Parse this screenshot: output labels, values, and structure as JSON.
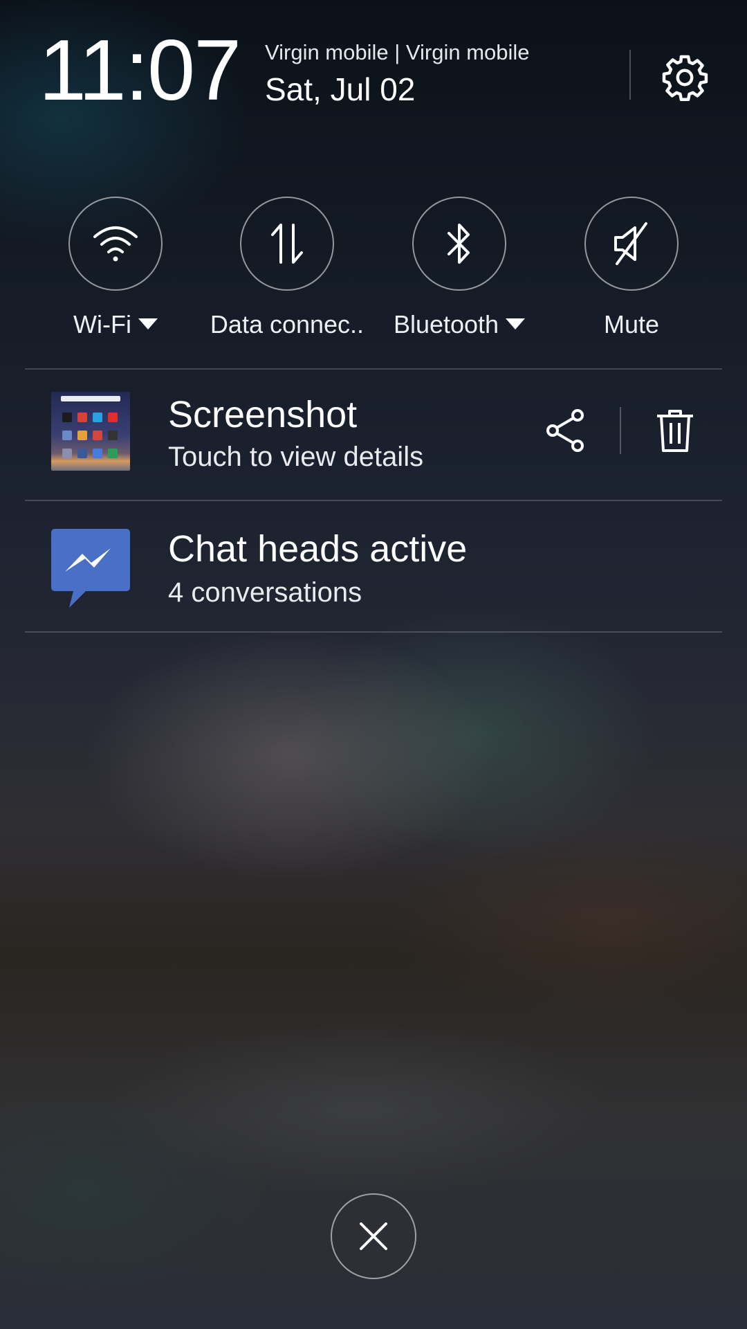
{
  "header": {
    "time": "11:07",
    "carrier": "Virgin mobile | Virgin mobile",
    "date": "Sat, Jul 02",
    "settings_icon": "gear-icon"
  },
  "toggles": [
    {
      "label": "Wi-Fi",
      "icon": "wifi-icon",
      "has_dropdown": true
    },
    {
      "label": "Data connec..",
      "icon": "data-connection-icon",
      "has_dropdown": false
    },
    {
      "label": "Bluetooth",
      "icon": "bluetooth-icon",
      "has_dropdown": true
    },
    {
      "label": "Mute",
      "icon": "mute-icon",
      "has_dropdown": false
    }
  ],
  "notifications": [
    {
      "title": "Screenshot",
      "subtitle": "Touch to view details",
      "icon": "screenshot-thumbnail",
      "actions": [
        "share-icon",
        "trash-icon"
      ]
    },
    {
      "title": "Chat heads active",
      "subtitle": "4 conversations",
      "icon": "messenger-icon"
    }
  ],
  "footer": {
    "close_icon": "close-icon"
  },
  "colors": {
    "messenger_blue": "#4a6fc7",
    "text": "#ffffff",
    "outline": "rgba(255,255,255,0.55)"
  }
}
